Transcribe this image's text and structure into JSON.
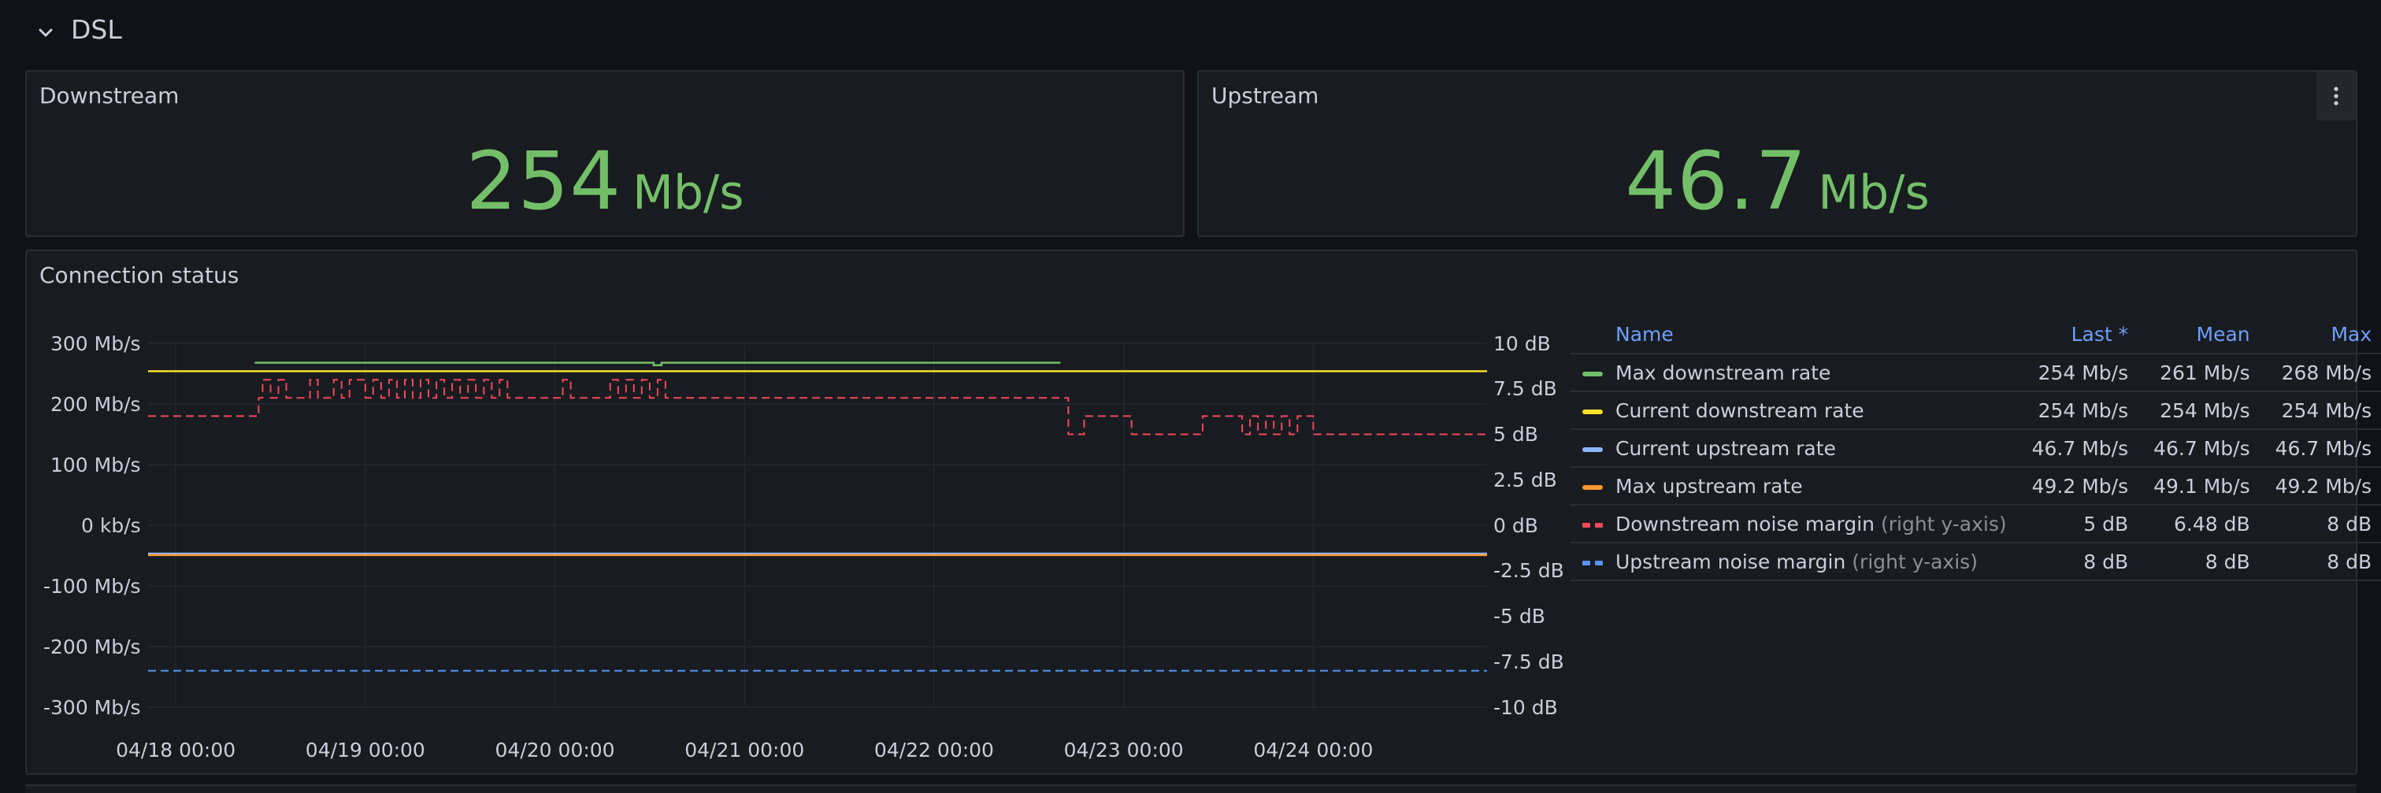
{
  "row": {
    "title": "DSL",
    "chevron_icon": "chevron-down-icon"
  },
  "downstream": {
    "title": "Downstream",
    "value": "254",
    "unit": "Mb/s",
    "color": "#73bf69"
  },
  "upstream": {
    "title": "Upstream",
    "value": "46.7",
    "unit": "Mb/s",
    "color": "#73bf69",
    "menu_icon": "kebab-menu-icon"
  },
  "connection": {
    "title": "Connection status",
    "legend": {
      "headers": {
        "name": "Name",
        "last": "Last *",
        "mean": "Mean",
        "max": "Max"
      },
      "rows": [
        {
          "name": "Max downstream rate",
          "note": "",
          "color": "#73bf69",
          "dashed": false,
          "last": "254 Mb/s",
          "mean": "261 Mb/s",
          "max": "268 Mb/s"
        },
        {
          "name": "Current downstream rate",
          "note": "",
          "color": "#fade2a",
          "dashed": false,
          "last": "254 Mb/s",
          "mean": "254 Mb/s",
          "max": "254 Mb/s"
        },
        {
          "name": "Current upstream rate",
          "note": "",
          "color": "#8ab8ff",
          "dashed": false,
          "last": "46.7 Mb/s",
          "mean": "46.7 Mb/s",
          "max": "46.7 Mb/s"
        },
        {
          "name": "Max upstream rate",
          "note": "",
          "color": "#ff9830",
          "dashed": false,
          "last": "49.2 Mb/s",
          "mean": "49.1 Mb/s",
          "max": "49.2 Mb/s"
        },
        {
          "name": "Downstream noise margin",
          "note": "(right y-axis)",
          "color": "#f2495c",
          "dashed": true,
          "last": "5 dB",
          "mean": "6.48 dB",
          "max": "8 dB"
        },
        {
          "name": "Upstream noise margin",
          "note": "(right y-axis)",
          "color": "#5794f2",
          "dashed": true,
          "last": "8 dB",
          "mean": "8 dB",
          "max": "8 dB"
        }
      ]
    }
  },
  "chart_data": {
    "type": "line",
    "x_tick_labels": [
      "04/18 00:00",
      "04/19 00:00",
      "04/20 00:00",
      "04/21 00:00",
      "04/22 00:00",
      "04/23 00:00",
      "04/24 00:00"
    ],
    "x_range": [
      "04/17 20:30",
      "04/24 22:00"
    ],
    "y_left": {
      "ticks": [
        "300 Mb/s",
        "200 Mb/s",
        "100 Mb/s",
        "0 kb/s",
        "-100 Mb/s",
        "-200 Mb/s",
        "-300 Mb/s"
      ],
      "range": [
        -300,
        300
      ],
      "unit": "Mb/s"
    },
    "y_right": {
      "ticks": [
        "10 dB",
        "7.5 dB",
        "5 dB",
        "2.5 dB",
        "0 dB",
        "-2.5 dB",
        "-5 dB",
        "-7.5 dB",
        "-10 dB"
      ],
      "range": [
        -10,
        10
      ],
      "unit": "dB"
    },
    "grid": true,
    "legend_placement": "right",
    "series": [
      {
        "name": "Max downstream rate",
        "axis": "left",
        "color": "#73bf69",
        "dashed": false,
        "points": [
          [
            "04/18 10:00",
            268
          ],
          [
            "04/20 12:00",
            268
          ],
          [
            "04/20 12:30",
            264
          ],
          [
            "04/20 13:30",
            268
          ],
          [
            "04/22 16:00",
            268
          ],
          [
            "04/22 16:30",
            null
          ]
        ]
      },
      {
        "name": "Current downstream rate",
        "axis": "left",
        "color": "#fade2a",
        "dashed": false,
        "points": [
          [
            "04/17 20:30",
            254
          ],
          [
            "04/24 22:00",
            254
          ]
        ]
      },
      {
        "name": "Current upstream rate",
        "axis": "left",
        "color": "#8ab8ff",
        "dashed": false,
        "points": [
          [
            "04/17 20:30",
            -46.7
          ],
          [
            "04/24 22:00",
            -46.7
          ]
        ]
      },
      {
        "name": "Max upstream rate",
        "axis": "left",
        "color": "#ff9830",
        "dashed": false,
        "points": [
          [
            "04/17 20:30",
            -49.2
          ],
          [
            "04/24 22:00",
            -49.2
          ]
        ]
      },
      {
        "name": "Downstream noise margin",
        "axis": "right",
        "color": "#f2495c",
        "dashed": true,
        "points": [
          [
            "04/17 20:30",
            6
          ],
          [
            "04/18 10:00",
            6
          ],
          [
            "04/18 10:30",
            7
          ],
          [
            "04/18 11:00",
            8
          ],
          [
            "04/18 12:00",
            7
          ],
          [
            "04/18 13:00",
            8
          ],
          [
            "04/18 14:00",
            7
          ],
          [
            "04/18 16:00",
            7
          ],
          [
            "04/18 17:00",
            8
          ],
          [
            "04/18 18:00",
            7
          ],
          [
            "04/18 20:00",
            8
          ],
          [
            "04/18 21:00",
            7
          ],
          [
            "04/18 22:00",
            8
          ],
          [
            "04/19 00:00",
            7
          ],
          [
            "04/19 01:00",
            8
          ],
          [
            "04/19 02:00",
            7
          ],
          [
            "04/19 03:00",
            8
          ],
          [
            "04/19 04:00",
            7
          ],
          [
            "04/19 05:00",
            8
          ],
          [
            "04/19 06:00",
            7
          ],
          [
            "04/19 07:00",
            8
          ],
          [
            "04/19 08:00",
            7
          ],
          [
            "04/19 09:00",
            8
          ],
          [
            "04/19 10:00",
            7
          ],
          [
            "04/19 11:00",
            8
          ],
          [
            "04/19 12:00",
            7
          ],
          [
            "04/19 13:00",
            8
          ],
          [
            "04/19 14:00",
            7
          ],
          [
            "04/19 15:00",
            8
          ],
          [
            "04/19 16:00",
            7
          ],
          [
            "04/19 17:00",
            8
          ],
          [
            "04/19 18:00",
            7
          ],
          [
            "04/19 20:00",
            7
          ],
          [
            "04/19 21:00",
            7
          ],
          [
            "04/20 00:00",
            7
          ],
          [
            "04/20 01:00",
            8
          ],
          [
            "04/20 02:00",
            7
          ],
          [
            "04/20 06:00",
            7
          ],
          [
            "04/20 07:00",
            8
          ],
          [
            "04/20 08:00",
            7
          ],
          [
            "04/20 09:00",
            8
          ],
          [
            "04/20 10:00",
            7
          ],
          [
            "04/20 11:00",
            8
          ],
          [
            "04/20 12:00",
            7
          ],
          [
            "04/20 13:00",
            8
          ],
          [
            "04/20 14:00",
            7
          ],
          [
            "04/22 16:00",
            7
          ],
          [
            "04/22 17:00",
            5
          ],
          [
            "04/22 18:00",
            5
          ],
          [
            "04/22 19:00",
            6
          ],
          [
            "04/23 00:00",
            6
          ],
          [
            "04/23 01:00",
            5
          ],
          [
            "04/23 09:00",
            5
          ],
          [
            "04/23 10:00",
            6
          ],
          [
            "04/23 14:00",
            6
          ],
          [
            "04/23 15:00",
            5
          ],
          [
            "04/23 16:00",
            6
          ],
          [
            "04/23 17:00",
            5
          ],
          [
            "04/23 18:00",
            6
          ],
          [
            "04/23 19:00",
            5
          ],
          [
            "04/23 20:00",
            6
          ],
          [
            "04/23 21:00",
            5
          ],
          [
            "04/23 22:00",
            6
          ],
          [
            "04/24 00:00",
            5
          ],
          [
            "04/24 22:00",
            5
          ]
        ]
      },
      {
        "name": "Upstream noise margin",
        "axis": "right",
        "color": "#5794f2",
        "dashed": true,
        "points": [
          [
            "04/17 20:30",
            -8
          ],
          [
            "04/24 22:00",
            -8
          ]
        ]
      }
    ]
  }
}
